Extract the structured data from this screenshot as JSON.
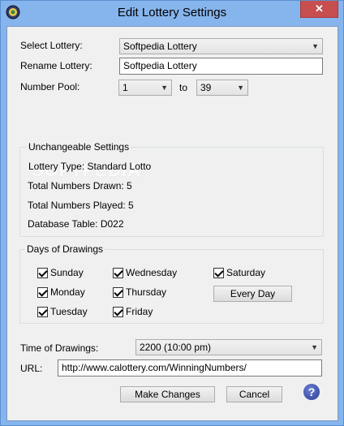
{
  "window": {
    "title": "Edit Lottery Settings",
    "close_symbol": "✕"
  },
  "form": {
    "select_lottery_label": "Select Lottery:",
    "select_lottery_value": "Softpedia Lottery",
    "rename_lottery_label": "Rename Lottery:",
    "rename_lottery_value": "Softpedia Lottery",
    "number_pool_label": "Number Pool:",
    "number_pool_from": "1",
    "number_pool_to_label": "to",
    "number_pool_to": "39"
  },
  "watermark": "SOFTPEDIA",
  "unchangeable": {
    "title": "Unchangeable Settings",
    "lottery_type": "Lottery Type: Standard Lotto",
    "total_drawn": "Total Numbers Drawn: 5",
    "total_played": "Total Numbers Played: 5",
    "database_table": "Database Table: D022"
  },
  "days": {
    "title": "Days of Drawings",
    "sunday": "Sunday",
    "monday": "Monday",
    "tuesday": "Tuesday",
    "wednesday": "Wednesday",
    "thursday": "Thursday",
    "friday": "Friday",
    "saturday": "Saturday",
    "every_day_button": "Every Day"
  },
  "time": {
    "label": "Time of Drawings:",
    "value": "2200 (10:00 pm)"
  },
  "url": {
    "label": "URL:",
    "value": "http://www.calottery.com/WinningNumbers/"
  },
  "buttons": {
    "make_changes": "Make Changes",
    "cancel": "Cancel",
    "help": "?"
  },
  "colors": {
    "titlebar": "#86b4ec",
    "close_button": "#c74f4f",
    "dialog_bg": "#f0f0f0"
  }
}
